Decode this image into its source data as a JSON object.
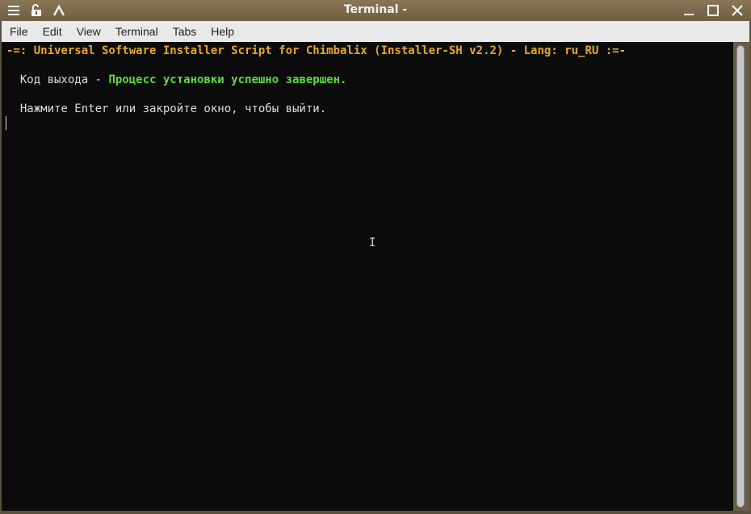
{
  "window": {
    "title": "Terminal -"
  },
  "titlebar_icons": {
    "left": [
      "menu-icon",
      "unlock-icon",
      "up-arrow-icon"
    ],
    "right": [
      "minimize-icon",
      "maximize-icon",
      "close-icon"
    ]
  },
  "menubar": {
    "items": [
      "File",
      "Edit",
      "View",
      "Terminal",
      "Tabs",
      "Help"
    ]
  },
  "terminal": {
    "header": "-=: Universal Software Installer Script for Chimbalix (Installer-SH v2.2) - Lang: ru_RU :=-",
    "exit_label": "  Код выхода - ",
    "exit_status": "Процесс установки успешно завершен.",
    "prompt": "  Нажмите Enter или закройте окно, чтобы выйти."
  },
  "colors": {
    "header": "#e5a82a",
    "success": "#5cdc3c",
    "text": "#dcdcdc",
    "background": "#0b0b0b"
  }
}
